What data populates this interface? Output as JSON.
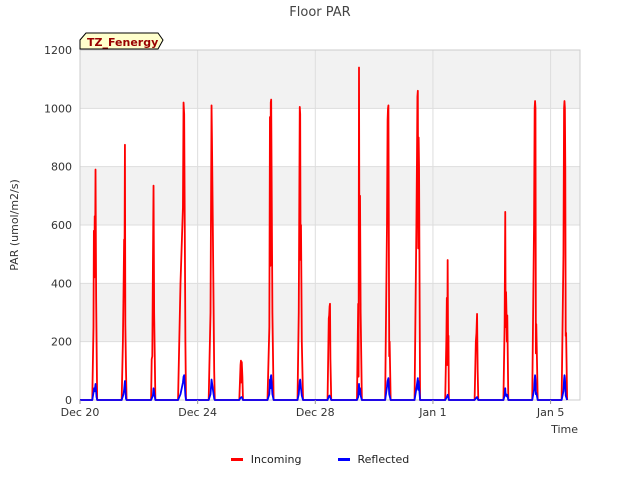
{
  "chart_data": {
    "type": "line",
    "title": "Floor PAR",
    "xlabel": "Time",
    "ylabel": "PAR (umol/m2/s)",
    "ylim": [
      0,
      1200
    ],
    "yticks": [
      0,
      200,
      400,
      600,
      800,
      1000,
      1200
    ],
    "xlim": [
      "2023-12-20",
      "2024-01-06"
    ],
    "xticks": [
      {
        "date": "2023-12-20",
        "label": "Dec 20"
      },
      {
        "date": "2023-12-24",
        "label": "Dec 24"
      },
      {
        "date": "2023-12-28",
        "label": "Dec 28"
      },
      {
        "date": "2024-01-01",
        "label": "Jan 1"
      },
      {
        "date": "2024-01-05",
        "label": "Jan 5"
      }
    ],
    "annotation": "TZ_Fenergy",
    "grid": true,
    "legend_position": "bottom",
    "series": [
      {
        "name": "Incoming",
        "color": "#ff0000",
        "points": [
          [
            "2023-12-20T10:00",
            0
          ],
          [
            "2023-12-20T11:00",
            250
          ],
          [
            "2023-12-20T11:20",
            580
          ],
          [
            "2023-12-20T11:40",
            420
          ],
          [
            "2023-12-20T12:00",
            630
          ],
          [
            "2023-12-20T12:20",
            500
          ],
          [
            "2023-12-20T12:40",
            790
          ],
          [
            "2023-12-20T13:10",
            350
          ],
          [
            "2023-12-20T14:00",
            0
          ],
          [
            "2023-12-21T10:00",
            0
          ],
          [
            "2023-12-21T11:00",
            200
          ],
          [
            "2023-12-21T11:30",
            360
          ],
          [
            "2023-12-21T12:00",
            550
          ],
          [
            "2023-12-21T12:20",
            480
          ],
          [
            "2023-12-21T12:40",
            875
          ],
          [
            "2023-12-21T13:00",
            260
          ],
          [
            "2023-12-21T13:30",
            110
          ],
          [
            "2023-12-21T14:00",
            0
          ],
          [
            "2023-12-22T10:00",
            0
          ],
          [
            "2023-12-22T10:30",
            140
          ],
          [
            "2023-12-22T11:00",
            150
          ],
          [
            "2023-12-22T11:30",
            460
          ],
          [
            "2023-12-22T12:00",
            735
          ],
          [
            "2023-12-22T12:30",
            300
          ],
          [
            "2023-12-22T13:30",
            0
          ],
          [
            "2023-12-23T08:00",
            0
          ],
          [
            "2023-12-23T10:00",
            400
          ],
          [
            "2023-12-23T12:00",
            660
          ],
          [
            "2023-12-23T12:30",
            1020
          ],
          [
            "2023-12-23T13:00",
            980
          ],
          [
            "2023-12-23T14:00",
            200
          ],
          [
            "2023-12-23T14:30",
            0
          ],
          [
            "2023-12-24T09:00",
            0
          ],
          [
            "2023-12-24T10:30",
            300
          ],
          [
            "2023-12-24T11:20",
            1010
          ],
          [
            "2023-12-24T11:40",
            900
          ],
          [
            "2023-12-24T12:20",
            620
          ],
          [
            "2023-12-24T13:30",
            100
          ],
          [
            "2023-12-24T14:00",
            0
          ],
          [
            "2023-12-25T10:00",
            0
          ],
          [
            "2023-12-25T11:00",
            120
          ],
          [
            "2023-12-25T11:20",
            135
          ],
          [
            "2023-12-25T11:40",
            60
          ],
          [
            "2023-12-25T12:00",
            130
          ],
          [
            "2023-12-25T12:30",
            80
          ],
          [
            "2023-12-25T13:00",
            0
          ],
          [
            "2023-12-26T09:00",
            0
          ],
          [
            "2023-12-26T10:30",
            250
          ],
          [
            "2023-12-26T11:00",
            970
          ],
          [
            "2023-12-26T11:20",
            460
          ],
          [
            "2023-12-26T11:40",
            1020
          ],
          [
            "2023-12-26T12:00",
            1030
          ],
          [
            "2023-12-26T13:00",
            300
          ],
          [
            "2023-12-26T14:00",
            0
          ],
          [
            "2023-12-27T09:30",
            0
          ],
          [
            "2023-12-27T10:30",
            300
          ],
          [
            "2023-12-27T11:20",
            1005
          ],
          [
            "2023-12-27T11:40",
            980
          ],
          [
            "2023-12-27T12:00",
            480
          ],
          [
            "2023-12-27T12:20",
            600
          ],
          [
            "2023-12-27T13:00",
            200
          ],
          [
            "2023-12-27T14:00",
            0
          ],
          [
            "2023-12-28T10:00",
            0
          ],
          [
            "2023-12-28T11:00",
            280
          ],
          [
            "2023-12-28T11:20",
            290
          ],
          [
            "2023-12-28T11:40",
            320
          ],
          [
            "2023-12-28T12:00",
            330
          ],
          [
            "2023-12-28T12:20",
            140
          ],
          [
            "2023-12-28T13:00",
            0
          ],
          [
            "2023-12-29T10:00",
            0
          ],
          [
            "2023-12-29T11:00",
            330
          ],
          [
            "2023-12-29T11:20",
            80
          ],
          [
            "2023-12-29T11:40",
            1140
          ],
          [
            "2023-12-29T12:00",
            500
          ],
          [
            "2023-12-29T12:30",
            700
          ],
          [
            "2023-12-29T13:00",
            300
          ],
          [
            "2023-12-29T14:00",
            0
          ],
          [
            "2023-12-30T09:00",
            0
          ],
          [
            "2023-12-30T10:30",
            600
          ],
          [
            "2023-12-30T11:00",
            960
          ],
          [
            "2023-12-30T11:20",
            1000
          ],
          [
            "2023-12-30T11:40",
            1010
          ],
          [
            "2023-12-30T12:20",
            150
          ],
          [
            "2023-12-30T12:40",
            200
          ],
          [
            "2023-12-30T13:30",
            0
          ],
          [
            "2023-12-31T09:00",
            0
          ],
          [
            "2023-12-31T10:30",
            600
          ],
          [
            "2023-12-31T11:00",
            840
          ],
          [
            "2023-12-31T11:20",
            1040
          ],
          [
            "2023-12-31T11:40",
            1060
          ],
          [
            "2023-12-31T12:00",
            520
          ],
          [
            "2023-12-31T12:20",
            900
          ],
          [
            "2023-12-31T12:40",
            800
          ],
          [
            "2023-12-31T13:30",
            0
          ],
          [
            "2024-01-01T10:00",
            0
          ],
          [
            "2024-01-01T11:00",
            220
          ],
          [
            "2024-01-01T11:20",
            350
          ],
          [
            "2024-01-01T11:40",
            120
          ],
          [
            "2024-01-01T12:00",
            480
          ],
          [
            "2024-01-01T12:20",
            200
          ],
          [
            "2024-01-01T12:40",
            220
          ],
          [
            "2024-01-01T13:00",
            0
          ],
          [
            "2024-01-02T10:00",
            0
          ],
          [
            "2024-01-02T11:00",
            200
          ],
          [
            "2024-01-02T11:30",
            230
          ],
          [
            "2024-01-02T12:00",
            295
          ],
          [
            "2024-01-02T12:30",
            100
          ],
          [
            "2024-01-02T13:00",
            0
          ],
          [
            "2024-01-03T09:30",
            0
          ],
          [
            "2024-01-03T10:30",
            260
          ],
          [
            "2024-01-03T11:00",
            645
          ],
          [
            "2024-01-03T11:20",
            250
          ],
          [
            "2024-01-03T11:40",
            370
          ],
          [
            "2024-01-03T12:00",
            300
          ],
          [
            "2024-01-03T12:20",
            200
          ],
          [
            "2024-01-03T12:40",
            290
          ],
          [
            "2024-01-03T13:30",
            0
          ],
          [
            "2024-01-04T09:00",
            0
          ],
          [
            "2024-01-04T10:30",
            600
          ],
          [
            "2024-01-04T11:00",
            1000
          ],
          [
            "2024-01-04T11:20",
            1025
          ],
          [
            "2024-01-04T11:40",
            1000
          ],
          [
            "2024-01-04T12:00",
            160
          ],
          [
            "2024-01-04T12:20",
            260
          ],
          [
            "2024-01-04T13:30",
            0
          ],
          [
            "2024-01-05T09:00",
            0
          ],
          [
            "2024-01-05T10:30",
            500
          ],
          [
            "2024-01-05T11:00",
            1000
          ],
          [
            "2024-01-05T11:20",
            1025
          ],
          [
            "2024-01-05T11:40",
            1000
          ],
          [
            "2024-01-05T12:00",
            800
          ],
          [
            "2024-01-05T12:20",
            220
          ],
          [
            "2024-01-05T12:40",
            230
          ],
          [
            "2024-01-05T13:30",
            0
          ]
        ]
      },
      {
        "name": "Reflected",
        "color": "#0000ff",
        "points": [
          [
            "2023-12-20T10:00",
            0
          ],
          [
            "2023-12-20T11:00",
            25
          ],
          [
            "2023-12-20T11:30",
            40
          ],
          [
            "2023-12-20T12:00",
            30
          ],
          [
            "2023-12-20T12:40",
            55
          ],
          [
            "2023-12-20T13:30",
            10
          ],
          [
            "2023-12-20T14:00",
            0
          ],
          [
            "2023-12-21T10:00",
            0
          ],
          [
            "2023-12-21T11:30",
            20
          ],
          [
            "2023-12-21T12:00",
            35
          ],
          [
            "2023-12-21T12:40",
            65
          ],
          [
            "2023-12-21T13:30",
            5
          ],
          [
            "2023-12-21T14:00",
            0
          ],
          [
            "2023-12-22T10:00",
            0
          ],
          [
            "2023-12-22T11:30",
            15
          ],
          [
            "2023-12-22T12:00",
            40
          ],
          [
            "2023-12-22T12:40",
            20
          ],
          [
            "2023-12-22T13:30",
            0
          ],
          [
            "2023-12-23T08:00",
            0
          ],
          [
            "2023-12-23T10:00",
            20
          ],
          [
            "2023-12-23T12:00",
            60
          ],
          [
            "2023-12-23T12:30",
            80
          ],
          [
            "2023-12-23T13:00",
            85
          ],
          [
            "2023-12-23T14:00",
            15
          ],
          [
            "2023-12-23T14:30",
            0
          ],
          [
            "2023-12-24T09:00",
            0
          ],
          [
            "2023-12-24T10:30",
            20
          ],
          [
            "2023-12-24T11:20",
            70
          ],
          [
            "2023-12-24T12:00",
            50
          ],
          [
            "2023-12-24T13:30",
            5
          ],
          [
            "2023-12-24T14:00",
            0
          ],
          [
            "2023-12-25T10:00",
            0
          ],
          [
            "2023-12-25T11:00",
            8
          ],
          [
            "2023-12-25T12:00",
            10
          ],
          [
            "2023-12-25T13:00",
            0
          ],
          [
            "2023-12-26T09:00",
            0
          ],
          [
            "2023-12-26T10:30",
            20
          ],
          [
            "2023-12-26T11:00",
            70
          ],
          [
            "2023-12-26T11:20",
            40
          ],
          [
            "2023-12-26T11:40",
            80
          ],
          [
            "2023-12-26T12:00",
            85
          ],
          [
            "2023-12-26T13:00",
            20
          ],
          [
            "2023-12-26T14:00",
            0
          ],
          [
            "2023-12-27T09:30",
            0
          ],
          [
            "2023-12-27T10:30",
            20
          ],
          [
            "2023-12-27T11:20",
            65
          ],
          [
            "2023-12-27T11:40",
            70
          ],
          [
            "2023-12-27T12:20",
            40
          ],
          [
            "2023-12-27T13:00",
            15
          ],
          [
            "2023-12-27T14:00",
            0
          ],
          [
            "2023-12-28T10:00",
            0
          ],
          [
            "2023-12-28T11:00",
            12
          ],
          [
            "2023-12-28T11:40",
            15
          ],
          [
            "2023-12-28T12:20",
            8
          ],
          [
            "2023-12-28T13:00",
            0
          ],
          [
            "2023-12-29T10:00",
            0
          ],
          [
            "2023-12-29T11:00",
            10
          ],
          [
            "2023-12-29T11:40",
            55
          ],
          [
            "2023-12-29T12:00",
            20
          ],
          [
            "2023-12-29T12:30",
            40
          ],
          [
            "2023-12-29T13:00",
            15
          ],
          [
            "2023-12-29T14:00",
            0
          ],
          [
            "2023-12-30T09:00",
            0
          ],
          [
            "2023-12-30T10:30",
            45
          ],
          [
            "2023-12-30T11:00",
            65
          ],
          [
            "2023-12-30T11:40",
            75
          ],
          [
            "2023-12-30T12:20",
            20
          ],
          [
            "2023-12-30T13:30",
            0
          ],
          [
            "2023-12-31T09:00",
            0
          ],
          [
            "2023-12-31T10:30",
            40
          ],
          [
            "2023-12-31T11:00",
            55
          ],
          [
            "2023-12-31T11:40",
            75
          ],
          [
            "2023-12-31T12:00",
            35
          ],
          [
            "2023-12-31T12:20",
            65
          ],
          [
            "2023-12-31T13:30",
            0
          ],
          [
            "2024-01-01T10:00",
            0
          ],
          [
            "2024-01-01T11:20",
            10
          ],
          [
            "2024-01-01T12:00",
            18
          ],
          [
            "2024-01-01T12:40",
            8
          ],
          [
            "2024-01-01T13:00",
            0
          ],
          [
            "2024-01-02T10:00",
            0
          ],
          [
            "2024-01-02T11:30",
            8
          ],
          [
            "2024-01-02T12:00",
            10
          ],
          [
            "2024-01-02T13:00",
            0
          ],
          [
            "2024-01-03T09:30",
            0
          ],
          [
            "2024-01-03T10:30",
            15
          ],
          [
            "2024-01-03T11:00",
            40
          ],
          [
            "2024-01-03T11:20",
            15
          ],
          [
            "2024-01-03T11:40",
            20
          ],
          [
            "2024-01-03T12:20",
            12
          ],
          [
            "2024-01-03T12:40",
            18
          ],
          [
            "2024-01-03T13:30",
            0
          ],
          [
            "2024-01-04T09:00",
            0
          ],
          [
            "2024-01-04T10:30",
            35
          ],
          [
            "2024-01-04T11:00",
            70
          ],
          [
            "2024-01-04T11:20",
            85
          ],
          [
            "2024-01-04T11:40",
            70
          ],
          [
            "2024-01-04T12:00",
            20
          ],
          [
            "2024-01-04T12:20",
            25
          ],
          [
            "2024-01-04T13:30",
            0
          ],
          [
            "2024-01-05T09:00",
            0
          ],
          [
            "2024-01-05T10:30",
            30
          ],
          [
            "2024-01-05T11:00",
            70
          ],
          [
            "2024-01-05T11:20",
            85
          ],
          [
            "2024-01-05T11:40",
            75
          ],
          [
            "2024-01-05T12:00",
            50
          ],
          [
            "2024-01-05T12:20",
            15
          ],
          [
            "2024-01-05T13:30",
            0
          ]
        ]
      }
    ]
  }
}
